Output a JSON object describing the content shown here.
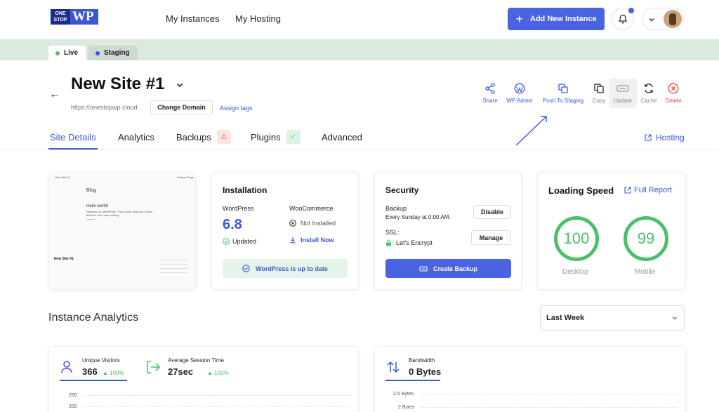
{
  "colors": {
    "accent": "#4a63e0",
    "success": "#4cbf6a",
    "danger": "#e0453a",
    "env_bar": "#dbeadf"
  },
  "brand": {
    "logo_line1": "ONE",
    "logo_line2": "STOP",
    "logo_mark": "WP"
  },
  "nav": {
    "links": [
      "My Instances",
      "My Hosting"
    ],
    "add_button": "Add New Instance",
    "icons": {
      "notifications": "bell-icon",
      "menu": "chevron-down-icon"
    }
  },
  "env_tabs": [
    {
      "label": "Live",
      "dot_color": "#4cbf6a",
      "active": true
    },
    {
      "label": "Staging",
      "dot_color": "#3a57d6",
      "active": false
    }
  ],
  "site": {
    "title": "New Site #1",
    "url": "https://onestopwp.cloud",
    "change_domain": "Change Domain",
    "assign_tags": "Assign tags"
  },
  "actions": [
    {
      "label": "Share",
      "icon": "share-icon"
    },
    {
      "label": "WP Admin",
      "icon": "wordpress-icon"
    },
    {
      "label": "Push To Staging",
      "icon": "push-icon"
    },
    {
      "label": "Copy",
      "icon": "copy-icon"
    },
    {
      "label": "Update",
      "icon": "update-icon"
    },
    {
      "label": "Cache",
      "icon": "refresh-icon"
    },
    {
      "label": "Delete",
      "icon": "delete-icon"
    }
  ],
  "tabs": [
    {
      "label": "Site Details",
      "active": true
    },
    {
      "label": "Analytics"
    },
    {
      "label": "Backups",
      "badge": "warning"
    },
    {
      "label": "Plugins",
      "badge": "ok"
    },
    {
      "label": "Advanced"
    }
  ],
  "hosting_link": "Hosting",
  "preview": {
    "site_name": "New Site #1",
    "blog_heading": "Blog",
    "post_title": "Hello world!",
    "post_excerpt": "Welcome to WordPress. This is your first post. Edit or delete it, then start writing!",
    "top_right": "Sample Page"
  },
  "installation": {
    "title": "Installation",
    "wp_label": "WordPress",
    "wp_version": "6.8",
    "wp_status": "Updated",
    "woo_label": "WooCommerce",
    "woo_status": "Not Installed",
    "woo_action": "Install Now",
    "banner": "WordPress is up to date"
  },
  "security": {
    "title": "Security",
    "backup_label": "Backup",
    "backup_schedule": "Every Sunday at 0:00 AM.",
    "disable_button": "Disable",
    "ssl_label": "SSL:",
    "ssl_value": "Let's Encrypt",
    "manage_button": "Manage",
    "create_backup": "Create Backup"
  },
  "speed": {
    "title": "Loading Speed",
    "report_link": "Full Report",
    "desktop_score": "100",
    "desktop_label": "Desktop",
    "mobile_score": "99",
    "mobile_label": "Mobile"
  },
  "analytics": {
    "title": "Instance Analytics",
    "range": "Last Week",
    "visitors_label": "Unique Visitors",
    "visitors_value": "366",
    "visitors_delta": "100%",
    "session_label": "Average Session Time",
    "session_value": "27sec",
    "session_delta": "100%",
    "bandwidth_label": "Bandwidth",
    "bandwidth_value": "0 Bytes",
    "left_ticks": [
      "250",
      "200"
    ],
    "right_ticks": [
      "2.5 Bytes",
      "2 Bytes"
    ]
  }
}
